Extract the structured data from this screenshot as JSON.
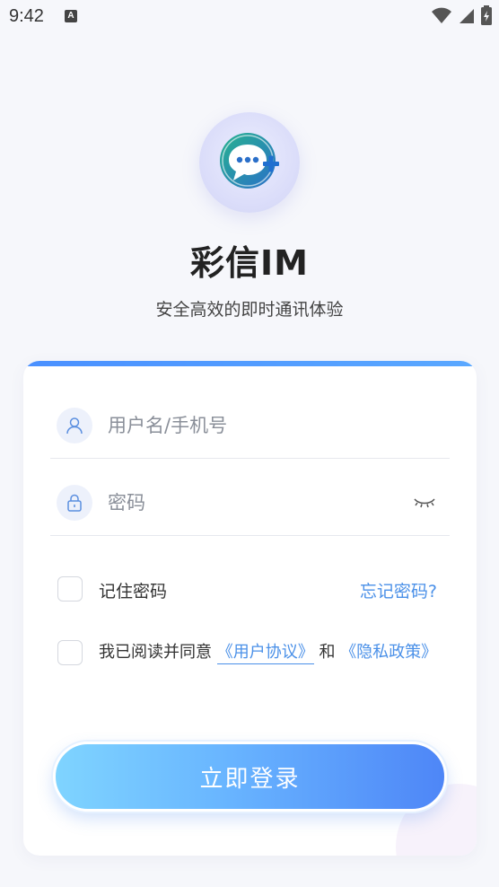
{
  "status_bar": {
    "time": "9:42",
    "notification_letter": "A"
  },
  "app": {
    "title": "彩信IM",
    "subtitle": "安全高效的即时通讯体验"
  },
  "login_form": {
    "username_placeholder": "用户名/手机号",
    "password_placeholder": "密码",
    "remember_label": "记住密码",
    "forgot_label": "忘记密码?",
    "agree_prefix": "我已阅读并同意 ",
    "user_agreement": "《用户协议》",
    "agree_and": " 和 ",
    "privacy_policy": "《隐私政策》",
    "login_button": "立即登录"
  },
  "colors": {
    "accent": "#4a90e8",
    "button_start": "#7fd4ff",
    "button_end": "#4e86f7"
  },
  "icons": [
    "wifi-icon",
    "cell-signal-icon",
    "battery-icon",
    "chat-plus-logo",
    "user-icon",
    "lock-icon",
    "eye-closed-icon"
  ]
}
